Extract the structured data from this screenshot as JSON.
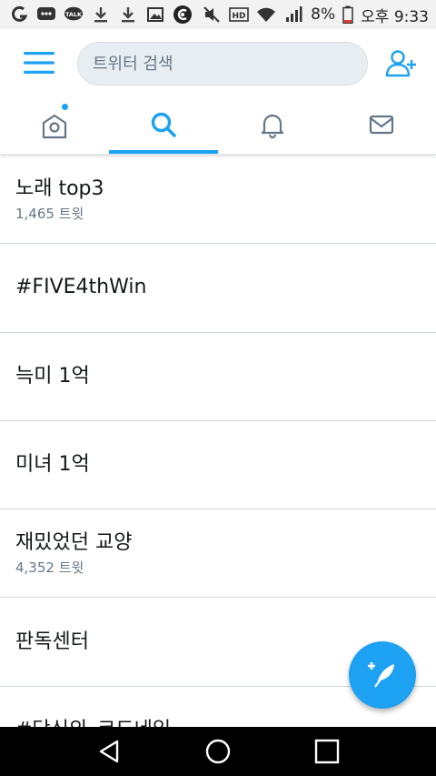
{
  "status_bar": {
    "battery": "8%",
    "time": "오후 9:33",
    "left_icons": [
      "g-app-icon",
      "message-icon",
      "kakaotalk-icon",
      "download-icon",
      "download-icon",
      "image-icon",
      "c-app-icon"
    ],
    "right_icons": [
      "mute-icon",
      "hd-icon",
      "wifi-icon",
      "signal-icon",
      "battery-icon"
    ]
  },
  "header": {
    "search_placeholder": "트위터 검색",
    "menu_icon": "hamburger-menu-icon",
    "add_user_icon": "add-user-icon"
  },
  "tabs": [
    {
      "name": "home",
      "icon": "home-icon",
      "active": false,
      "has_dot": true
    },
    {
      "name": "search",
      "icon": "search-icon",
      "active": true
    },
    {
      "name": "notifications",
      "icon": "bell-icon",
      "active": false
    },
    {
      "name": "messages",
      "icon": "envelope-icon",
      "active": false
    }
  ],
  "trends": [
    {
      "title": "노래 top3",
      "count": "1,465 트윗"
    },
    {
      "title": "#FIVE4thWin",
      "count": ""
    },
    {
      "title": "늑미 1억",
      "count": ""
    },
    {
      "title": "미녀 1억",
      "count": ""
    },
    {
      "title": "재밌었던 교양",
      "count": "4,352 트윗"
    },
    {
      "title": "판독센터",
      "count": ""
    },
    {
      "title": "#당신의_코드네임",
      "count": ""
    }
  ],
  "colors": {
    "accent": "#1da1f2",
    "secondary_text": "#657786"
  }
}
